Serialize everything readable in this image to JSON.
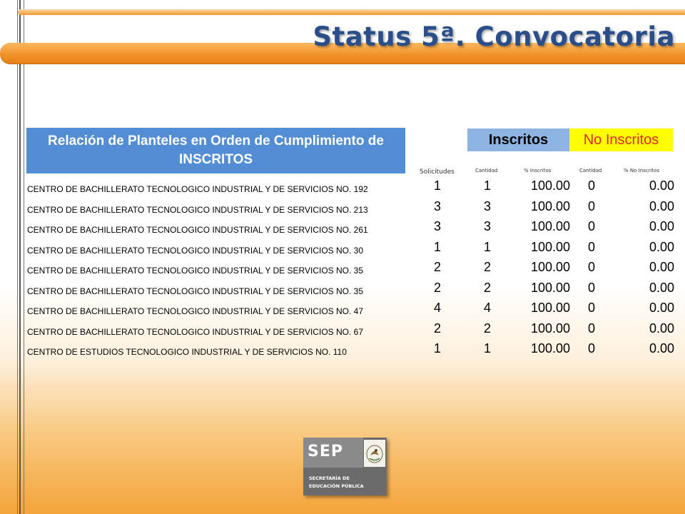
{
  "header": {
    "title": "Status 5ª. Convocatoria"
  },
  "table": {
    "header_relacion": "Relación de Planteles en Orden de Cumplimiento de INSCRITOS",
    "header_inscritos": "Inscritos",
    "header_no_inscritos": "No Inscritos",
    "sub_solicitudes": "Solicitudes",
    "sub_cantidad": "Cantidad",
    "sub_pct_inscritos": "% Inscritos",
    "sub_cantidad_no": "Cantidad",
    "sub_pct_no_inscritos": "% No Inscritos",
    "rows": [
      {
        "name": "CENTRO DE BACHILLERATO TECNOLOGICO INDUSTRIAL Y DE SERVICIOS NO. 192",
        "solicitudes": "1",
        "cantidad": "1",
        "pct": "100.00",
        "no_cantidad": "0",
        "no_pct": "0.00"
      },
      {
        "name": "CENTRO DE BACHILLERATO TECNOLOGICO INDUSTRIAL Y DE SERVICIOS NO. 213",
        "solicitudes": "3",
        "cantidad": "3",
        "pct": "100.00",
        "no_cantidad": "0",
        "no_pct": "0.00"
      },
      {
        "name": "CENTRO DE BACHILLERATO TECNOLOGICO INDUSTRIAL Y DE SERVICIOS NO. 261",
        "solicitudes": "3",
        "cantidad": "3",
        "pct": "100.00",
        "no_cantidad": "0",
        "no_pct": "0.00"
      },
      {
        "name": "CENTRO DE BACHILLERATO TECNOLOGICO INDUSTRIAL Y DE SERVICIOS NO. 30",
        "solicitudes": "1",
        "cantidad": "1",
        "pct": "100.00",
        "no_cantidad": "0",
        "no_pct": "0.00"
      },
      {
        "name": "CENTRO DE BACHILLERATO TECNOLOGICO INDUSTRIAL Y DE SERVICIOS NO. 35",
        "solicitudes": "2",
        "cantidad": "2",
        "pct": "100.00",
        "no_cantidad": "0",
        "no_pct": "0.00"
      },
      {
        "name": "CENTRO DE BACHILLERATO TECNOLOGICO INDUSTRIAL Y DE SERVICIOS NO. 35",
        "solicitudes": "2",
        "cantidad": "2",
        "pct": "100.00",
        "no_cantidad": "0",
        "no_pct": "0.00"
      },
      {
        "name": "CENTRO DE BACHILLERATO TECNOLOGICO INDUSTRIAL Y DE SERVICIOS NO. 47",
        "solicitudes": "4",
        "cantidad": "4",
        "pct": "100.00",
        "no_cantidad": "0",
        "no_pct": "0.00"
      },
      {
        "name": "CENTRO DE BACHILLERATO TECNOLOGICO INDUSTRIAL Y DE SERVICIOS NO. 67",
        "solicitudes": "2",
        "cantidad": "2",
        "pct": "100.00",
        "no_cantidad": "0",
        "no_pct": "0.00"
      },
      {
        "name": "CENTRO DE ESTUDIOS TECNOLOGICO INDUSTRIAL Y DE SERVICIOS NO. 110",
        "solicitudes": "1",
        "cantidad": "1",
        "pct": "100.00",
        "no_cantidad": "0",
        "no_pct": "0.00"
      }
    ]
  },
  "logo": {
    "acronym": "SEP",
    "line1": "SECRETARÍA DE",
    "line2": "EDUCACIÓN PÚBLICA",
    "icon": "mexican-eagle-seal-icon"
  },
  "colors": {
    "title": "#2a4e8a",
    "relacion_header": "#538dd5",
    "inscritos_header": "#8db4e2",
    "no_inscritos_header": "#ffff00",
    "no_inscritos_text": "#e0281f",
    "banner": "#f0922a"
  }
}
